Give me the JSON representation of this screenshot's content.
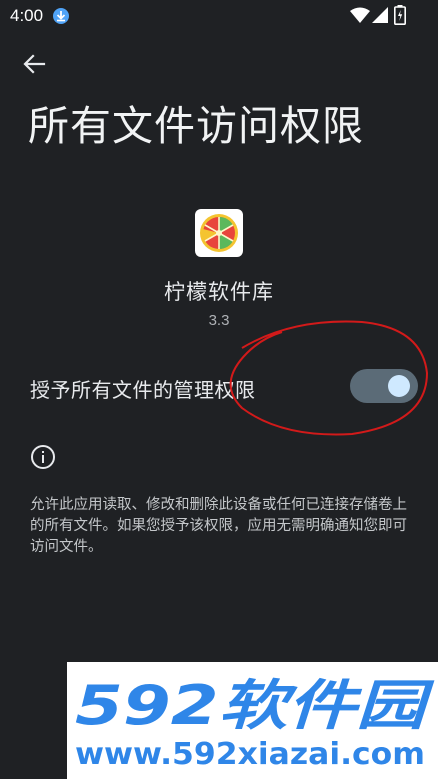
{
  "status_bar": {
    "time": "4:00",
    "icons": [
      "download-icon",
      "wifi-icon",
      "signal-icon",
      "battery-icon"
    ]
  },
  "header": {
    "back_icon": "arrow-back-icon",
    "title": "所有文件访问权限"
  },
  "app": {
    "name": "柠檬软件库",
    "version": "3.3",
    "icon": "lemon-slice-icon"
  },
  "permission": {
    "label": "授予所有文件的管理权限",
    "enabled": true
  },
  "info": {
    "icon": "info-icon",
    "description": "允许此应用读取、修改和删除此设备或任何已连接存储卷上的所有文件。如果您授予该权限，应用无需明确通知您即可访问文件。"
  },
  "watermark": {
    "logo_text": "592软件园",
    "url": "www.592xiazai.com"
  },
  "colors": {
    "background": "#1f2124",
    "toggle_track": "#5b6b77",
    "toggle_thumb": "#cfe9ff",
    "annotation": "#d21a1a",
    "watermark_blue": "#2f86e8"
  }
}
